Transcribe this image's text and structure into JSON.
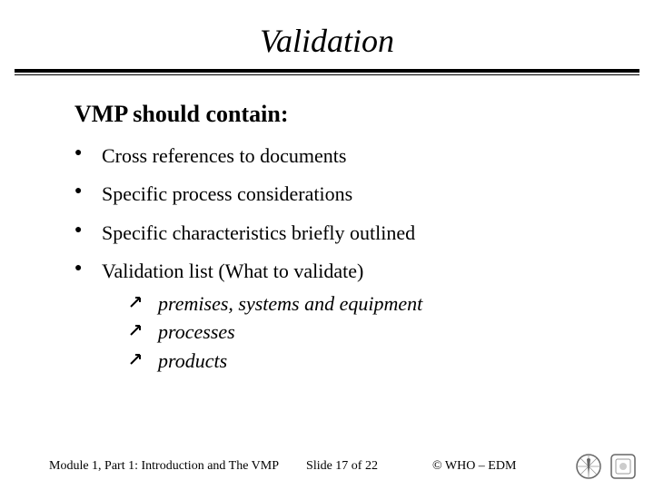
{
  "title": "Validation",
  "heading": "VMP should contain:",
  "bullets": [
    "Cross references to documents",
    "Specific process considerations",
    "Specific characteristics briefly outlined",
    "Validation list (What to validate)"
  ],
  "sub_bullets": [
    "premises, systems and equipment",
    "processes",
    "products"
  ],
  "footer": {
    "module": "Module 1, Part 1: Introduction and The VMP",
    "pager": "Slide 17 of 22",
    "attribution": "© WHO – EDM"
  }
}
